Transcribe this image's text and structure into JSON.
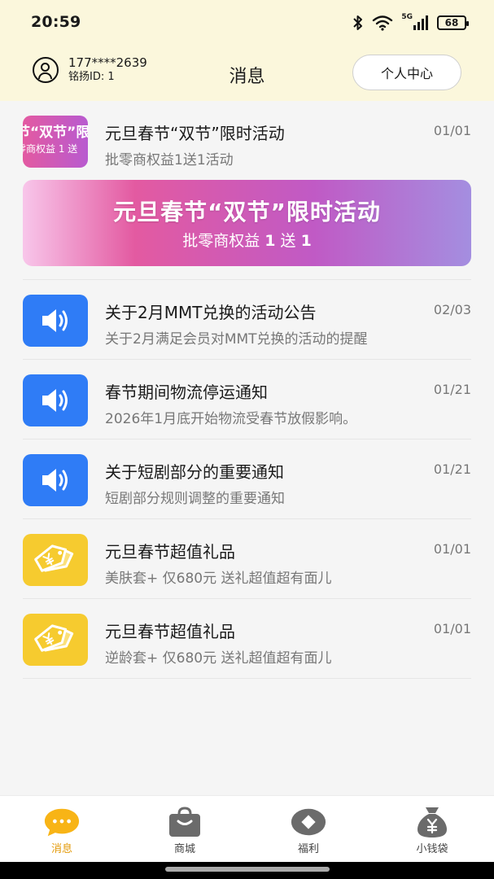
{
  "status_bar": {
    "time": "20:59",
    "network": "5G",
    "battery": "68"
  },
  "header": {
    "phone": "177****2639",
    "user_id": "铭扬ID: 1",
    "title": "消息",
    "profile_button": "个人中心"
  },
  "messages": [
    {
      "icon": "promo-thumbnail",
      "title": "元旦春节“双节”限时活动",
      "subtitle": "批零商权益1送1活动",
      "date": "01/01",
      "thumb_line1": "节“双节”限",
      "thumb_line2": "零商权益 1 送"
    },
    {
      "icon": "speaker-icon",
      "title": "关于2月MMT兑换的活动公告",
      "subtitle": "关于2月满足会员对MMT兑换的活动的提醒",
      "date": "02/03"
    },
    {
      "icon": "speaker-icon",
      "title": "春节期间物流停运通知",
      "subtitle": "2026年1月底开始物流受春节放假影响。",
      "date": "01/21"
    },
    {
      "icon": "speaker-icon",
      "title": "关于短剧部分的重要通知",
      "subtitle": "短剧部分规则调整的重要通知",
      "date": "01/21"
    },
    {
      "icon": "price-tag-icon",
      "title": "元旦春节超值礼品",
      "subtitle": "美肤套+ 仅680元 送礼超值超有面儿",
      "date": "01/01"
    },
    {
      "icon": "price-tag-icon",
      "title": "元旦春节超值礼品",
      "subtitle": "逆龄套+ 仅680元 送礼超值超有面儿",
      "date": "01/01"
    }
  ],
  "banner": {
    "title": "元旦春节“双节”限时活动",
    "sub_prefix": "批零商权益 ",
    "sub_num1": "1",
    "sub_mid": " 送 ",
    "sub_num2": "1"
  },
  "tabs": [
    {
      "label": "消息",
      "icon": "chat-bubble-icon",
      "active": true
    },
    {
      "label": "商城",
      "icon": "shopping-bag-icon",
      "active": false
    },
    {
      "label": "福利",
      "icon": "diamond-icon",
      "active": false
    },
    {
      "label": "小钱袋",
      "icon": "money-bag-icon",
      "active": false
    }
  ],
  "colors": {
    "header_bg": "#fbf7dc",
    "blue_icon": "#2f7cf6",
    "yellow_icon": "#f6cb2f",
    "active_tab": "#e39a0a"
  }
}
